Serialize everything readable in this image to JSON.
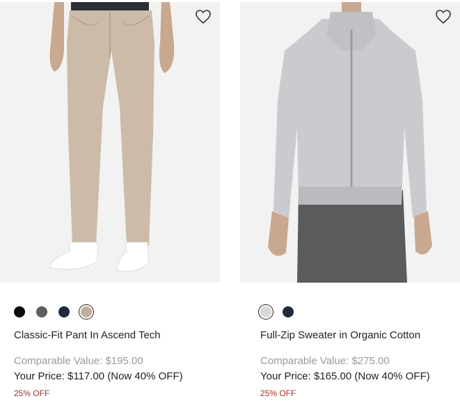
{
  "products": [
    {
      "name": "Classic-Fit Pant In Ascend Tech",
      "comparable_value": "Comparable Value: $195.00",
      "your_price": "Your Price: $117.00 (Now 40% OFF)",
      "discount_badge": "25% OFF",
      "image_icon": "khaki-pants-photo",
      "swatches": [
        {
          "color": "#0b0b0b",
          "selected": false
        },
        {
          "color": "#5e5e5e",
          "selected": false
        },
        {
          "color": "#1f2a3a",
          "selected": false
        },
        {
          "color": "#bfae9b",
          "selected": true
        }
      ]
    },
    {
      "name": "Full-Zip Sweater in Organic Cotton",
      "comparable_value": "Comparable Value: $275.00",
      "your_price": "Your Price: $165.00 (Now 40% OFF)",
      "discount_badge": "25% OFF",
      "image_icon": "grey-zip-sweater-photo",
      "swatches": [
        {
          "color": "#d9d9d9",
          "selected": true
        },
        {
          "color": "#1f2a3a",
          "selected": false
        }
      ]
    }
  ],
  "colors": {
    "accent_discount": "#a0322a",
    "muted_text": "#9a9a9a",
    "image_bg": "#f2f2f2"
  }
}
